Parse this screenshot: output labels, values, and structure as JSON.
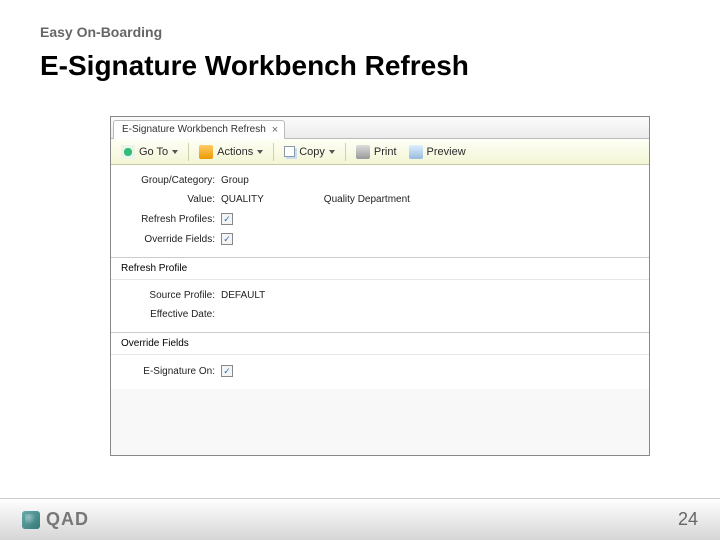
{
  "slide": {
    "breadcrumb": "Easy On-Boarding",
    "title": "E-Signature Workbench Refresh",
    "page_number": "24",
    "brand": "QAD"
  },
  "tab": {
    "label": "E-Signature Workbench Refresh"
  },
  "toolbar": {
    "goto": "Go To",
    "actions": "Actions",
    "copy": "Copy",
    "print": "Print",
    "preview": "Preview"
  },
  "form": {
    "group_label": "Group/Category:",
    "group_value": "Group",
    "value_label": "Value:",
    "value_value": "QUALITY",
    "value_desc": "Quality Department",
    "refresh_profiles_label": "Refresh Profiles:",
    "refresh_profiles_checked": true,
    "override_fields_label": "Override Fields:",
    "override_fields_checked": true
  },
  "sections": {
    "refresh_profile": "Refresh Profile",
    "source_profile_label": "Source Profile:",
    "source_profile_value": "DEFAULT",
    "effective_date_label": "Effective Date:",
    "effective_date_value": "",
    "override_fields_hdr": "Override Fields",
    "esig_on_label": "E-Signature On:",
    "esig_on_checked": true
  }
}
